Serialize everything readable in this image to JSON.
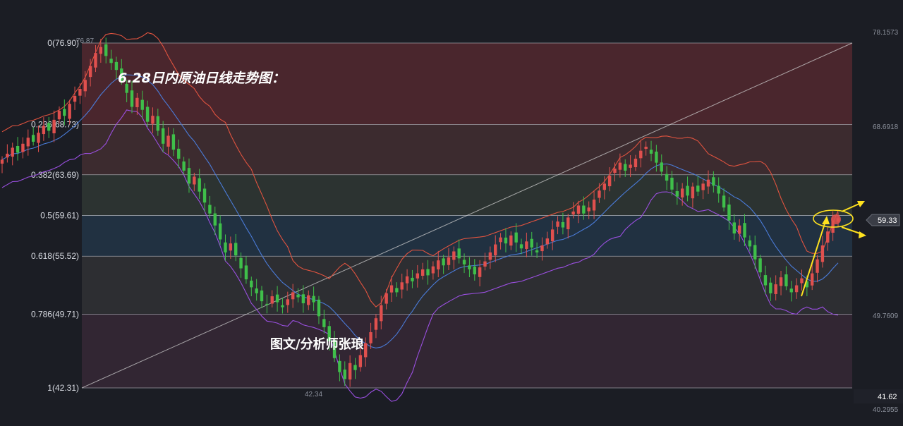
{
  "chart_data": {
    "type": "candlestick",
    "title": "6.28日内原油日线走势图：",
    "credit": "图文/分析师张琅",
    "fib_levels": [
      {
        "ratio": "0",
        "price": 76.9,
        "label": "0(76.90)",
        "fill": "#7a2f36"
      },
      {
        "ratio": "0.236",
        "price": 68.73,
        "label": "0.236(68.73)",
        "fill": "#5e3a3a"
      },
      {
        "ratio": "0.382",
        "price": 63.69,
        "label": "0.382(63.69)",
        "fill": "#3e4a3e"
      },
      {
        "ratio": "0.5",
        "price": 59.61,
        "label": "0.5(59.61)",
        "fill": "#27455e"
      },
      {
        "ratio": "0.618",
        "price": 55.52,
        "label": "0.618(55.52)",
        "fill": "#403f3f"
      },
      {
        "ratio": "0.786",
        "price": 49.71,
        "label": "0.786(49.71)",
        "fill": "#4a3042"
      },
      {
        "ratio": "1",
        "price": 42.31,
        "label": "1(42.31)",
        "fill": null
      }
    ],
    "right_axis_labels": [
      "78.1573",
      "68.6918",
      "49.7609",
      "40.2955"
    ],
    "current_price": "59.33",
    "bottom_price_label": "41.62",
    "peak_label": "76.87",
    "trough_label": "42.34",
    "colors": {
      "up": "#e0504e",
      "down": "#3fbf4a",
      "mid_band": "#4a7bd8",
      "upper_band": "#e0533f",
      "lower_band": "#9a4fe0",
      "trend": "#cfcfcf",
      "arrow": "#ffe21f"
    },
    "closes": [
      65.2,
      65.8,
      66.4,
      65.9,
      66.8,
      67.4,
      67.0,
      67.9,
      68.6,
      68.1,
      69.2,
      70.1,
      69.6,
      70.8,
      71.6,
      72.3,
      73.2,
      74.6,
      75.9,
      76.5,
      75.6,
      74.9,
      74.2,
      73.1,
      71.9,
      70.5,
      71.4,
      70.2,
      69.0,
      69.6,
      68.1,
      66.8,
      67.6,
      66.2,
      65.3,
      64.1,
      62.8,
      63.5,
      62.0,
      60.9,
      59.8,
      58.6,
      57.2,
      55.9,
      56.8,
      55.6,
      54.3,
      53.2,
      52.4,
      51.8,
      51.0,
      50.7,
      51.5,
      50.9,
      50.4,
      51.2,
      51.9,
      51.4,
      50.8,
      51.6,
      50.9,
      49.5,
      48.4,
      47.0,
      45.3,
      43.9,
      43.2,
      44.8,
      44.1,
      45.6,
      46.8,
      47.9,
      49.3,
      50.6,
      51.8,
      52.6,
      51.9,
      52.9,
      53.5,
      53.0,
      53.8,
      54.2,
      53.6,
      54.5,
      55.1,
      54.6,
      55.4,
      56.0,
      55.3,
      54.7,
      54.2,
      53.7,
      54.4,
      55.0,
      55.9,
      56.7,
      57.4,
      56.8,
      57.6,
      56.9,
      56.3,
      57.0,
      56.4,
      55.9,
      56.6,
      57.3,
      58.2,
      59.0,
      58.4,
      59.4,
      60.0,
      60.6,
      59.8,
      60.4,
      61.2,
      62.1,
      62.8,
      63.6,
      64.3,
      64.9,
      64.1,
      64.7,
      65.3,
      66.1,
      66.5,
      65.8,
      64.9,
      64.0,
      63.1,
      62.2,
      61.5,
      62.3,
      61.6,
      62.5,
      62.0,
      62.8,
      63.2,
      62.6,
      61.8,
      60.4,
      59.1,
      57.8,
      58.6,
      57.4,
      56.5,
      55.2,
      53.9,
      52.6,
      51.8,
      52.7,
      53.4,
      52.5,
      51.9,
      52.6,
      53.3,
      52.4,
      53.8,
      55.2,
      56.6,
      58.0,
      59.1,
      59.33
    ]
  }
}
